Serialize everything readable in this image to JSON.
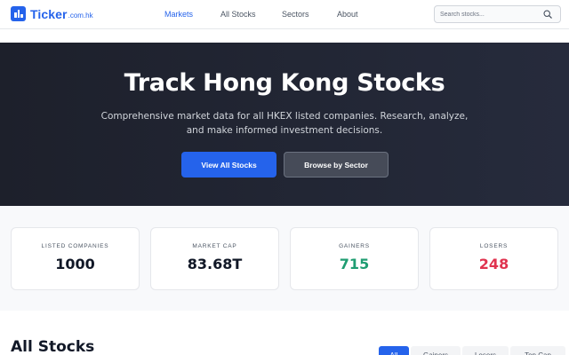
{
  "brand": {
    "name": "Ticker",
    "suffix": ".com.hk",
    "color": "#2563eb"
  },
  "nav": [
    {
      "label": "Markets",
      "active": true
    },
    {
      "label": "All Stocks",
      "active": false
    },
    {
      "label": "Sectors",
      "active": false
    },
    {
      "label": "About",
      "active": false
    }
  ],
  "search": {
    "placeholder": "Search stocks...",
    "icon": "search-icon"
  },
  "hero": {
    "title": "Track Hong Kong Stocks",
    "subtitle": "Comprehensive market data for all HKEX listed companies. Research, analyze, and make informed investment decisions.",
    "primary_button": "View All Stocks",
    "secondary_button": "Browse by Sector"
  },
  "stats": [
    {
      "label": "LISTED COMPANIES",
      "value": "1000",
      "tone": "neutral"
    },
    {
      "label": "MARKET CAP",
      "value": "83.68T",
      "tone": "neutral"
    },
    {
      "label": "GAINERS",
      "value": "715",
      "tone": "positive"
    },
    {
      "label": "LOSERS",
      "value": "248",
      "tone": "negative"
    }
  ],
  "all_stocks": {
    "title": "All Stocks",
    "tabs": [
      {
        "label": "All",
        "active": true
      },
      {
        "label": "Gainers",
        "active": false
      },
      {
        "label": "Losers",
        "active": false
      },
      {
        "label": "Top Cap",
        "active": false
      }
    ]
  },
  "colors": {
    "accent": "#2563eb",
    "positive": "#1f9d72",
    "negative": "#e0334f",
    "hero_bg": "#1d202b"
  }
}
